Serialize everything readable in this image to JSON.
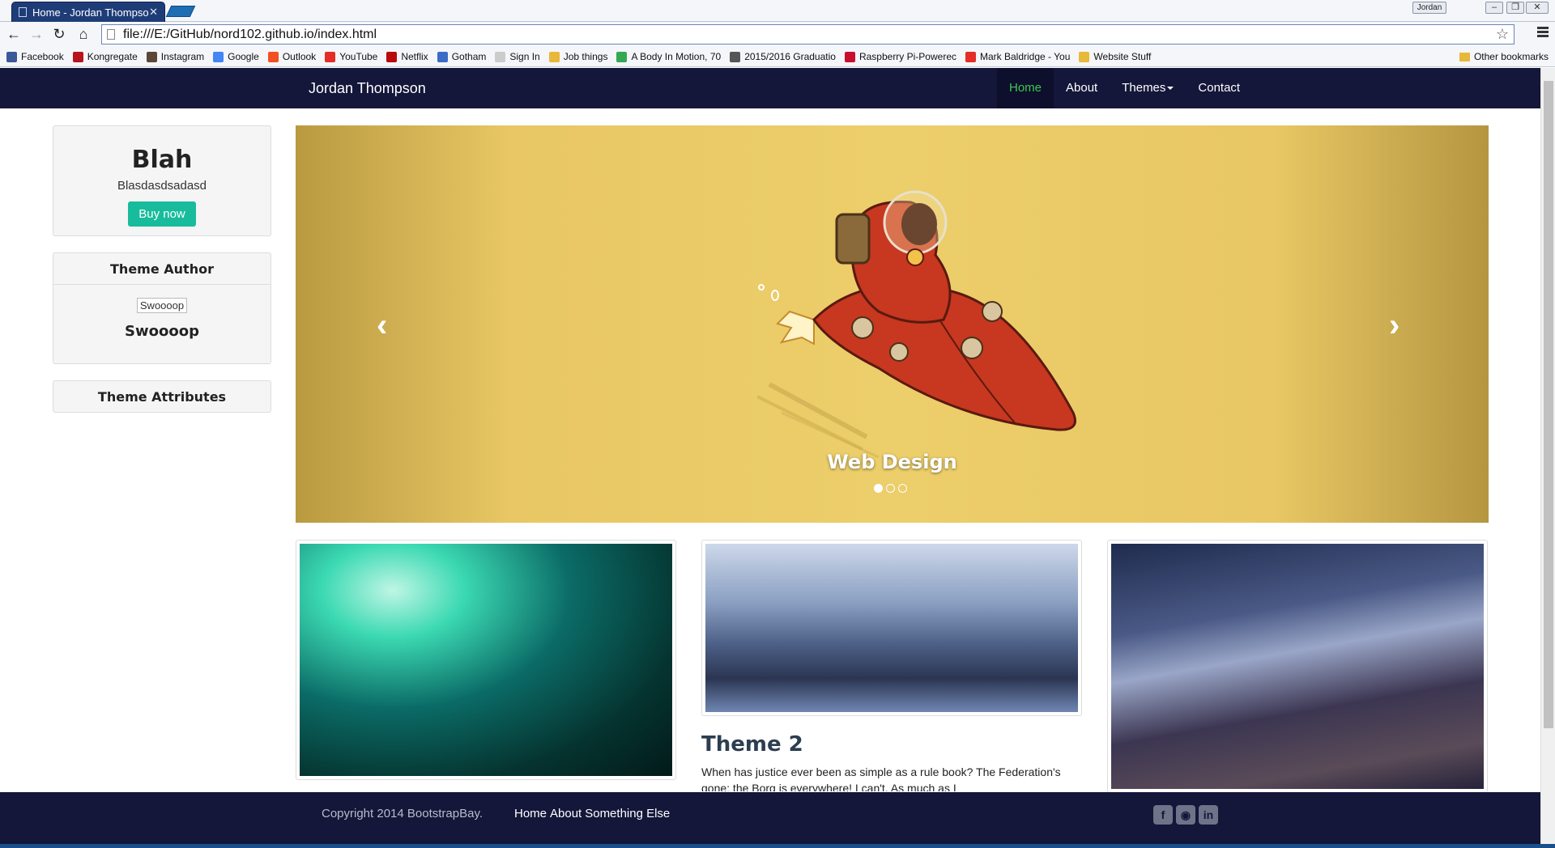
{
  "browser": {
    "tab_title": "Home - Jordan Thompson",
    "tab_close": "✕",
    "profile": "Jordan",
    "url": "file:///E:/GitHub/nord102.github.io/index.html",
    "bookmarks": [
      {
        "label": "Facebook",
        "icon": "facebook-icon",
        "color": "#3b5998"
      },
      {
        "label": "Kongregate",
        "icon": "kongregate-icon",
        "color": "#b7141b"
      },
      {
        "label": "Instagram",
        "icon": "instagram-icon",
        "color": "#5c4636"
      },
      {
        "label": "Google",
        "icon": "google-icon",
        "color": "#4285f4"
      },
      {
        "label": "Outlook",
        "icon": "outlook-icon",
        "color": "#f25022"
      },
      {
        "label": "YouTube",
        "icon": "youtube-icon",
        "color": "#e52d27"
      },
      {
        "label": "Netflix",
        "icon": "netflix-icon",
        "color": "#b9090b"
      },
      {
        "label": "Gotham",
        "icon": "gotham-icon",
        "color": "#3a6cc6"
      },
      {
        "label": "Sign In",
        "icon": "page-icon",
        "color": "#cccccc"
      },
      {
        "label": "Job things",
        "icon": "folder-icon",
        "color": "#e8b83a"
      },
      {
        "label": "A Body In Motion, 70",
        "icon": "maps-icon",
        "color": "#34a853"
      },
      {
        "label": "2015/2016 Graduatio",
        "icon": "graduation-icon",
        "color": "#555555"
      },
      {
        "label": "Raspberry Pi-Powerec",
        "icon": "m-icon",
        "color": "#c8102e"
      },
      {
        "label": "Mark Baldridge - You",
        "icon": "youtube-icon",
        "color": "#e52d27"
      },
      {
        "label": "Website Stuff",
        "icon": "folder-icon",
        "color": "#e8b83a"
      }
    ],
    "other_bookmarks": "Other bookmarks"
  },
  "nav": {
    "brand": "Jordan Thompson",
    "items": [
      "Home",
      "About",
      "Themes",
      "Contact"
    ],
    "active_color": "#3fc650"
  },
  "sidebar": {
    "promo_title": "Blah",
    "promo_text": "Blasdasdsadasd",
    "buy_label": "Buy now",
    "author_heading": "Theme Author",
    "author_image_alt": "Swoooop",
    "author_name": "Swoooop",
    "attributes_heading": "Theme Attributes"
  },
  "carousel": {
    "caption": "Web Design",
    "prev": "‹",
    "next": "›",
    "slide_count": 3,
    "active_slide": 1
  },
  "themes": {
    "theme2_title": "Theme 2",
    "theme2_text": "When has justice ever been as simple as a rule book? The Federation's gone; the Borg is everywhere! I can't. As much as I"
  },
  "footer": {
    "copyright": "Copyright 2014 BootstrapBay.",
    "links": [
      "Home",
      "About",
      "Something Else"
    ],
    "socials": [
      "facebook-icon",
      "github-icon",
      "linkedin-icon"
    ]
  },
  "colors": {
    "navbar": "#14163a",
    "accent": "#18bc9c",
    "carousel_bg": "#ecce6a"
  }
}
